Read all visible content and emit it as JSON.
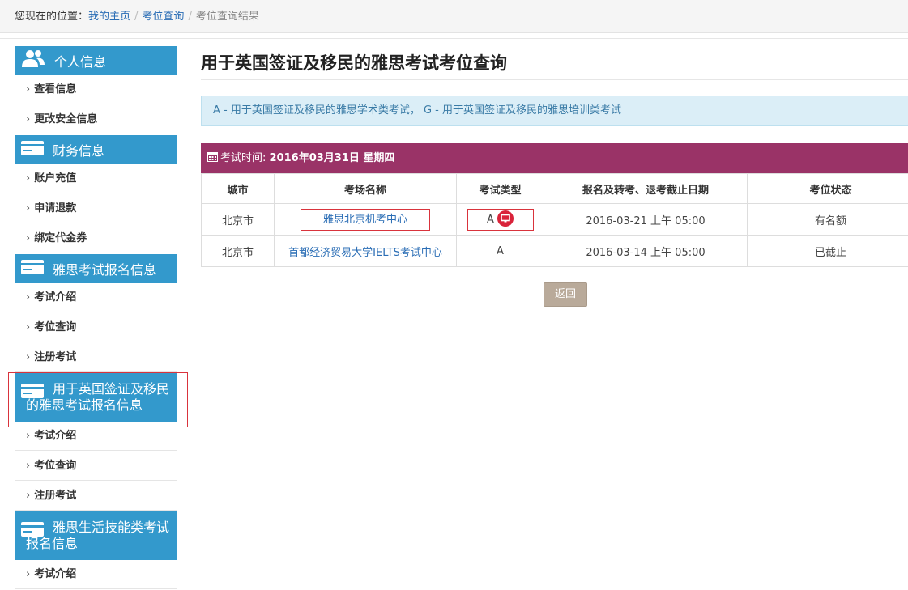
{
  "breadcrumb": {
    "prefix": "您现在的位置：",
    "items": [
      "我的主页",
      "考位查询"
    ],
    "current": "考位查询结果"
  },
  "sidebar": {
    "sections": [
      {
        "title": "个人信息",
        "icon": "users-icon",
        "items": [
          "查看信息",
          "更改安全信息"
        ]
      },
      {
        "title": "财务信息",
        "icon": "card-icon",
        "items": [
          "账户充值",
          "申请退款",
          "绑定代金券"
        ]
      },
      {
        "title": "雅思考试报名信息",
        "icon": "card-icon",
        "items": [
          "考试介绍",
          "考位查询",
          "注册考试"
        ]
      },
      {
        "title": "用于英国签证及移民的雅思考试报名信息",
        "icon": "card-icon",
        "items": [
          "考试介绍",
          "考位查询",
          "注册考试"
        ]
      },
      {
        "title": "雅思生活技能类考试报名信息",
        "icon": "card-icon",
        "items": [
          "考试介绍"
        ]
      }
    ]
  },
  "main": {
    "title": "用于英国签证及移民的雅思考试考位查询",
    "info": "A - 用于英国签证及移民的雅思学术类考试， G - 用于英国签证及移民的雅思培训类考试",
    "exam_label": "考试时间:",
    "exam_date": "2016年03月31日 星期四",
    "columns": [
      "城市",
      "考场名称",
      "考试类型",
      "报名及转考、退考截止日期",
      "考位状态"
    ],
    "rows": [
      {
        "city": "北京市",
        "center": "雅思北京机考中心",
        "type": "A",
        "deadline": "2016-03-21 上午 05:00",
        "status": "有名额"
      },
      {
        "city": "北京市",
        "center": "首都经济贸易大学IELTS考试中心",
        "type": "A",
        "deadline": "2016-03-14 上午 05:00",
        "status": "已截止"
      }
    ],
    "back_label": "返回"
  },
  "colors": {
    "sidebar_header": "#3399cc",
    "exam_header": "#9a3367",
    "info_bg": "#dbeef7",
    "link": "#2a6db5",
    "highlight_border": "#d9333c",
    "back_button": "#b9aa9a"
  }
}
